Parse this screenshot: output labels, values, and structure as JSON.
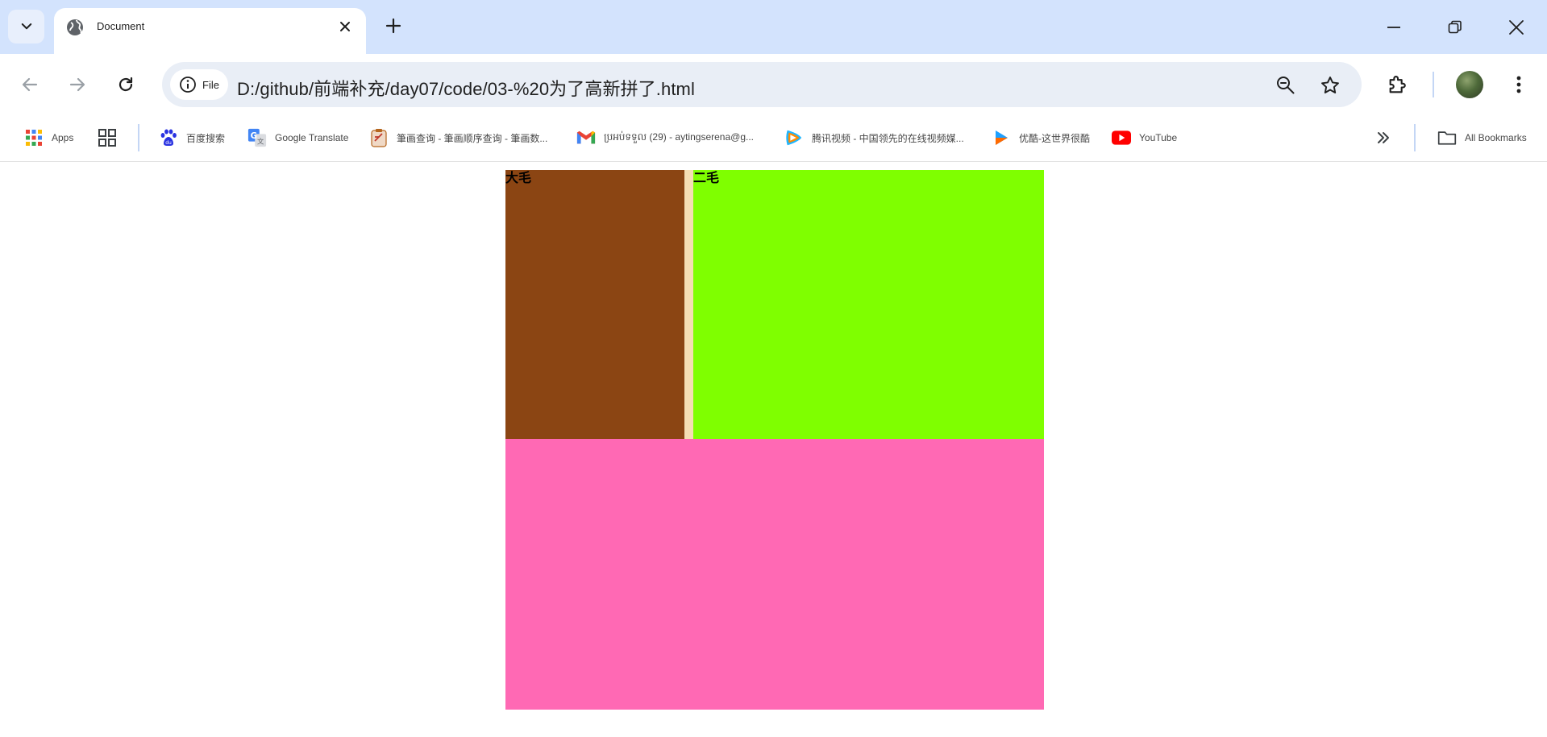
{
  "tab": {
    "title": "Document",
    "favicon": "globe-icon"
  },
  "toolbar": {
    "chip_label": "File",
    "url": "D:/github/前端补充/day07/code/03-%20为了高新拼了.html"
  },
  "bookmarks": [
    {
      "label": "Apps",
      "icon": "apps-grid-icon"
    },
    {
      "label": "",
      "icon": "tab-groups-icon"
    },
    {
      "label": "百度搜索",
      "icon": "baidu-icon"
    },
    {
      "label": "Google Translate",
      "icon": "google-translate-icon"
    },
    {
      "label": "筆画查询 - 筆画顺序查询 - 筆画数...",
      "icon": "clipboard-icon"
    },
    {
      "label": "ប្រអប់ទទួល (29) - aytingserena@g...",
      "icon": "gmail-icon"
    },
    {
      "label": "腾讯视频 - 中国领先的在线视频媒...",
      "icon": "tencent-video-icon"
    },
    {
      "label": "优酷-这世界很酷",
      "icon": "youku-icon"
    },
    {
      "label": "YouTube",
      "icon": "youtube-icon"
    }
  ],
  "all_bookmarks_label": "All Bookmarks",
  "page": {
    "box1_label": "大毛",
    "box2_label": "二毛",
    "colors": {
      "box1": "#8b4513",
      "gap": "#f5deb3",
      "box2": "#7fff00",
      "bottom": "#ff69b4"
    }
  },
  "colors": {
    "tabstrip": "#d3e3fd",
    "omnibox": "#e9eef6"
  }
}
